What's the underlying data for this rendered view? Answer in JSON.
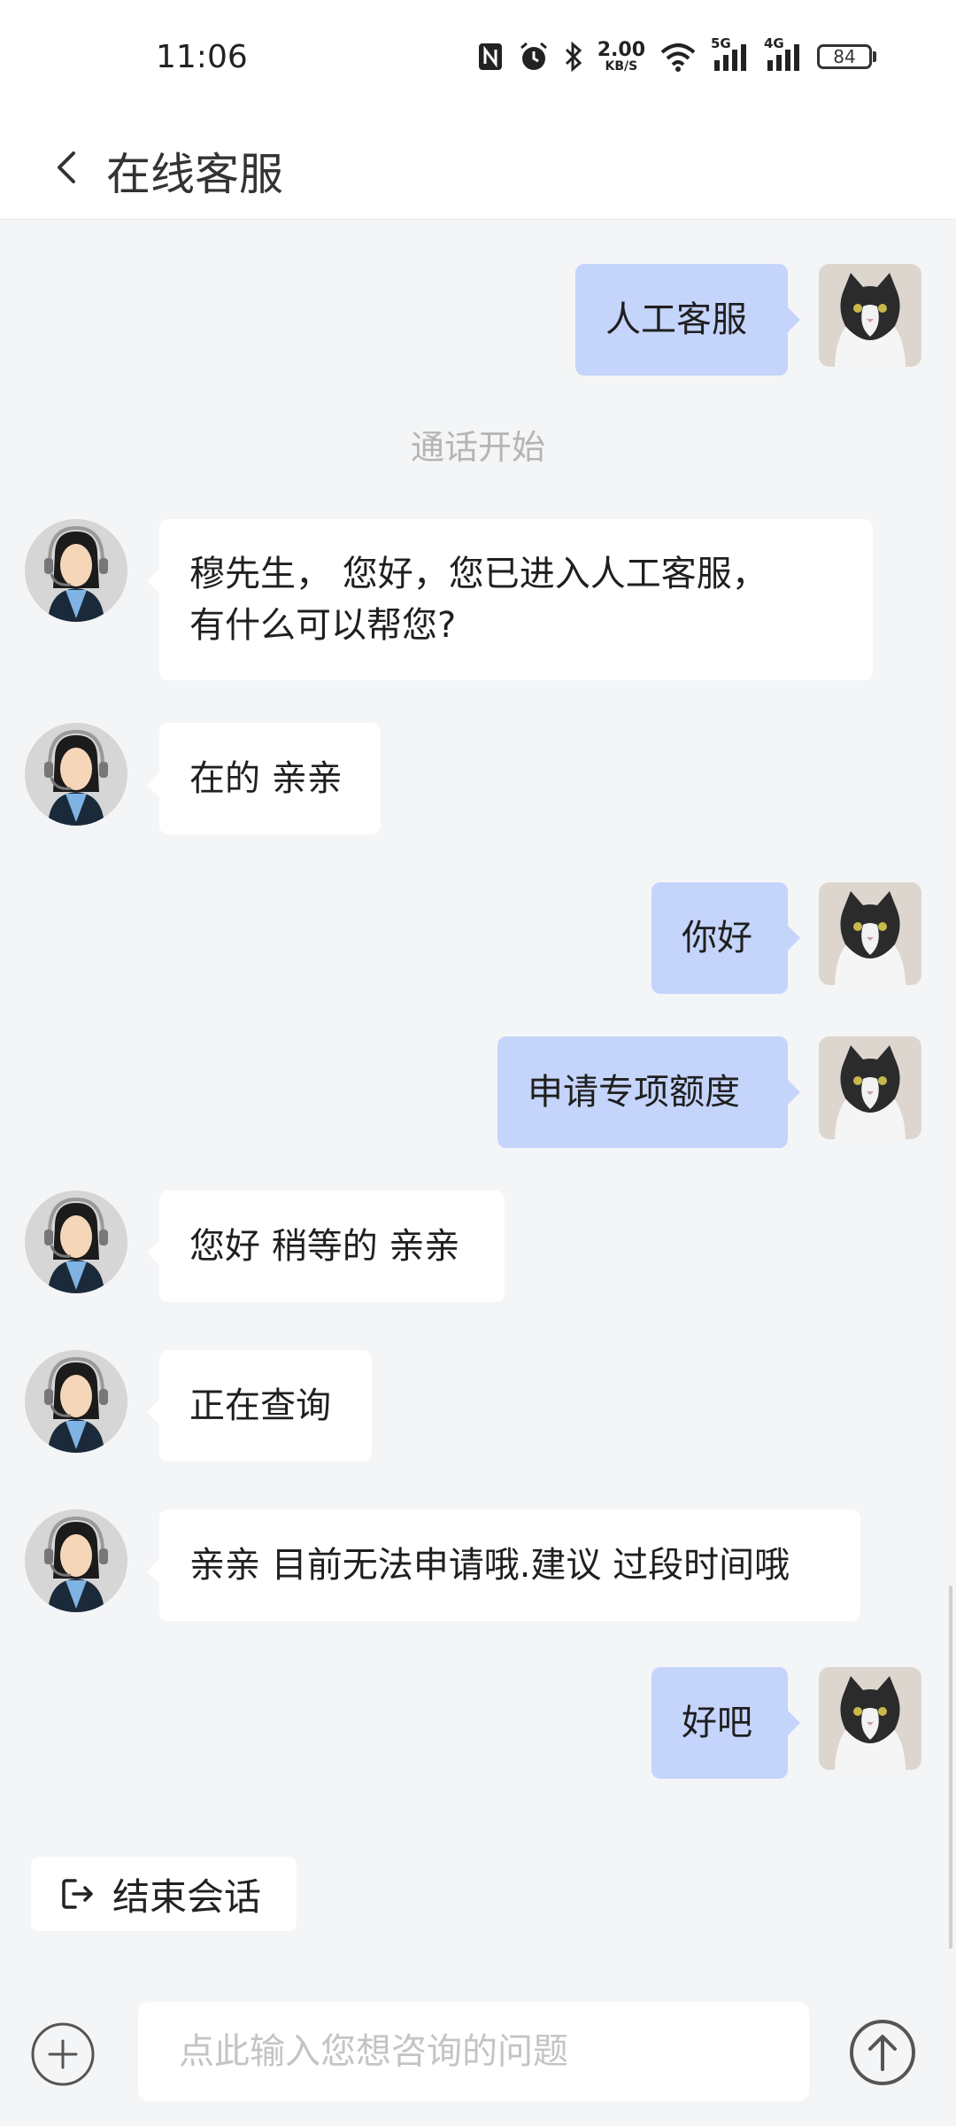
{
  "status_bar": {
    "time": "11:06",
    "net_speed_value": "2.00",
    "net_speed_unit": "KB/S",
    "network_1": "5G",
    "network_2": "4G",
    "battery_level": "84"
  },
  "header": {
    "title": "在线客服"
  },
  "chat": {
    "messages": [
      {
        "from": "user",
        "text": "人工客服"
      },
      {
        "from": "system",
        "text": "通话开始"
      },
      {
        "from": "agent",
        "text_line1": "穆先生，  您好，您已进入人工客服，",
        "text_line2": "有什么可以帮您?"
      },
      {
        "from": "agent",
        "text": "在的 亲亲"
      },
      {
        "from": "user",
        "text": "你好"
      },
      {
        "from": "user",
        "text": "申请专项额度"
      },
      {
        "from": "agent",
        "text": "您好 稍等的 亲亲"
      },
      {
        "from": "agent",
        "text": "正在查询"
      },
      {
        "from": "agent",
        "text": "亲亲 目前无法申请哦.建议 过段时间哦"
      },
      {
        "from": "user",
        "text": "好吧"
      }
    ]
  },
  "actions": {
    "end_session_label": "结束会话"
  },
  "composer": {
    "placeholder": "点此输入您想咨询的问题"
  },
  "colors": {
    "user_bubble": "#c5d4fb",
    "agent_bubble": "#ffffff",
    "background": "#f4f5f7"
  },
  "icons": [
    "back-icon",
    "logout-icon",
    "plus-icon",
    "send-icon",
    "nfc-icon",
    "alarm-icon",
    "bluetooth-icon",
    "wifi-icon",
    "signal-icon",
    "battery-icon"
  ]
}
